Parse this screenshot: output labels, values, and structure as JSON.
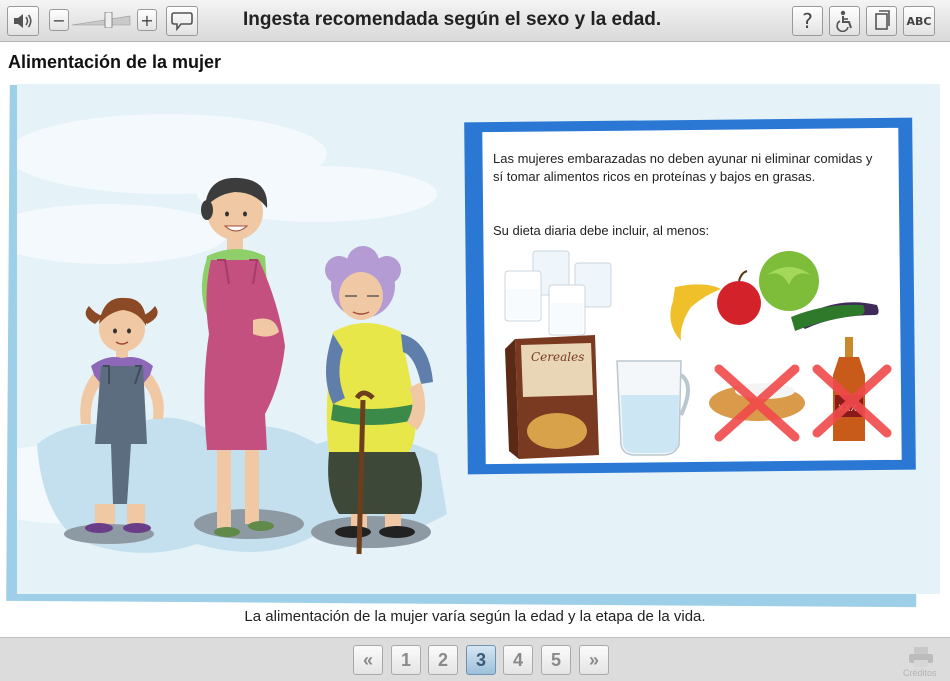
{
  "toolbar": {
    "title": "Ingesta recomendada según el sexo y la edad.",
    "zoom_out_label": "−",
    "zoom_in_label": "+",
    "help_label": "?",
    "abc_label": "ABC",
    "icons": [
      "speaker-icon",
      "speech-bubble-icon",
      "help-icon",
      "wheelchair-icon",
      "document-icon"
    ]
  },
  "page": {
    "heading": "Alimentación de la mujer"
  },
  "info_card": {
    "paragraph": "Las mujeres embarazadas no deben ayunar ni eliminar comidas y sí tomar alimentos ricos en proteínas y bajos en grasas.",
    "subheading": "Su dieta diaria debe incluir, al menos:",
    "cereal_brand": "Cereales",
    "bottle_label": "XXX"
  },
  "caption": "La alimentación de la mujer varía según la edad y la etapa de la vida.",
  "pagination": {
    "first": "«",
    "pages": [
      "1",
      "2",
      "3",
      "4",
      "5"
    ],
    "current": "3",
    "last": "»"
  },
  "print_label": "Créditos"
}
